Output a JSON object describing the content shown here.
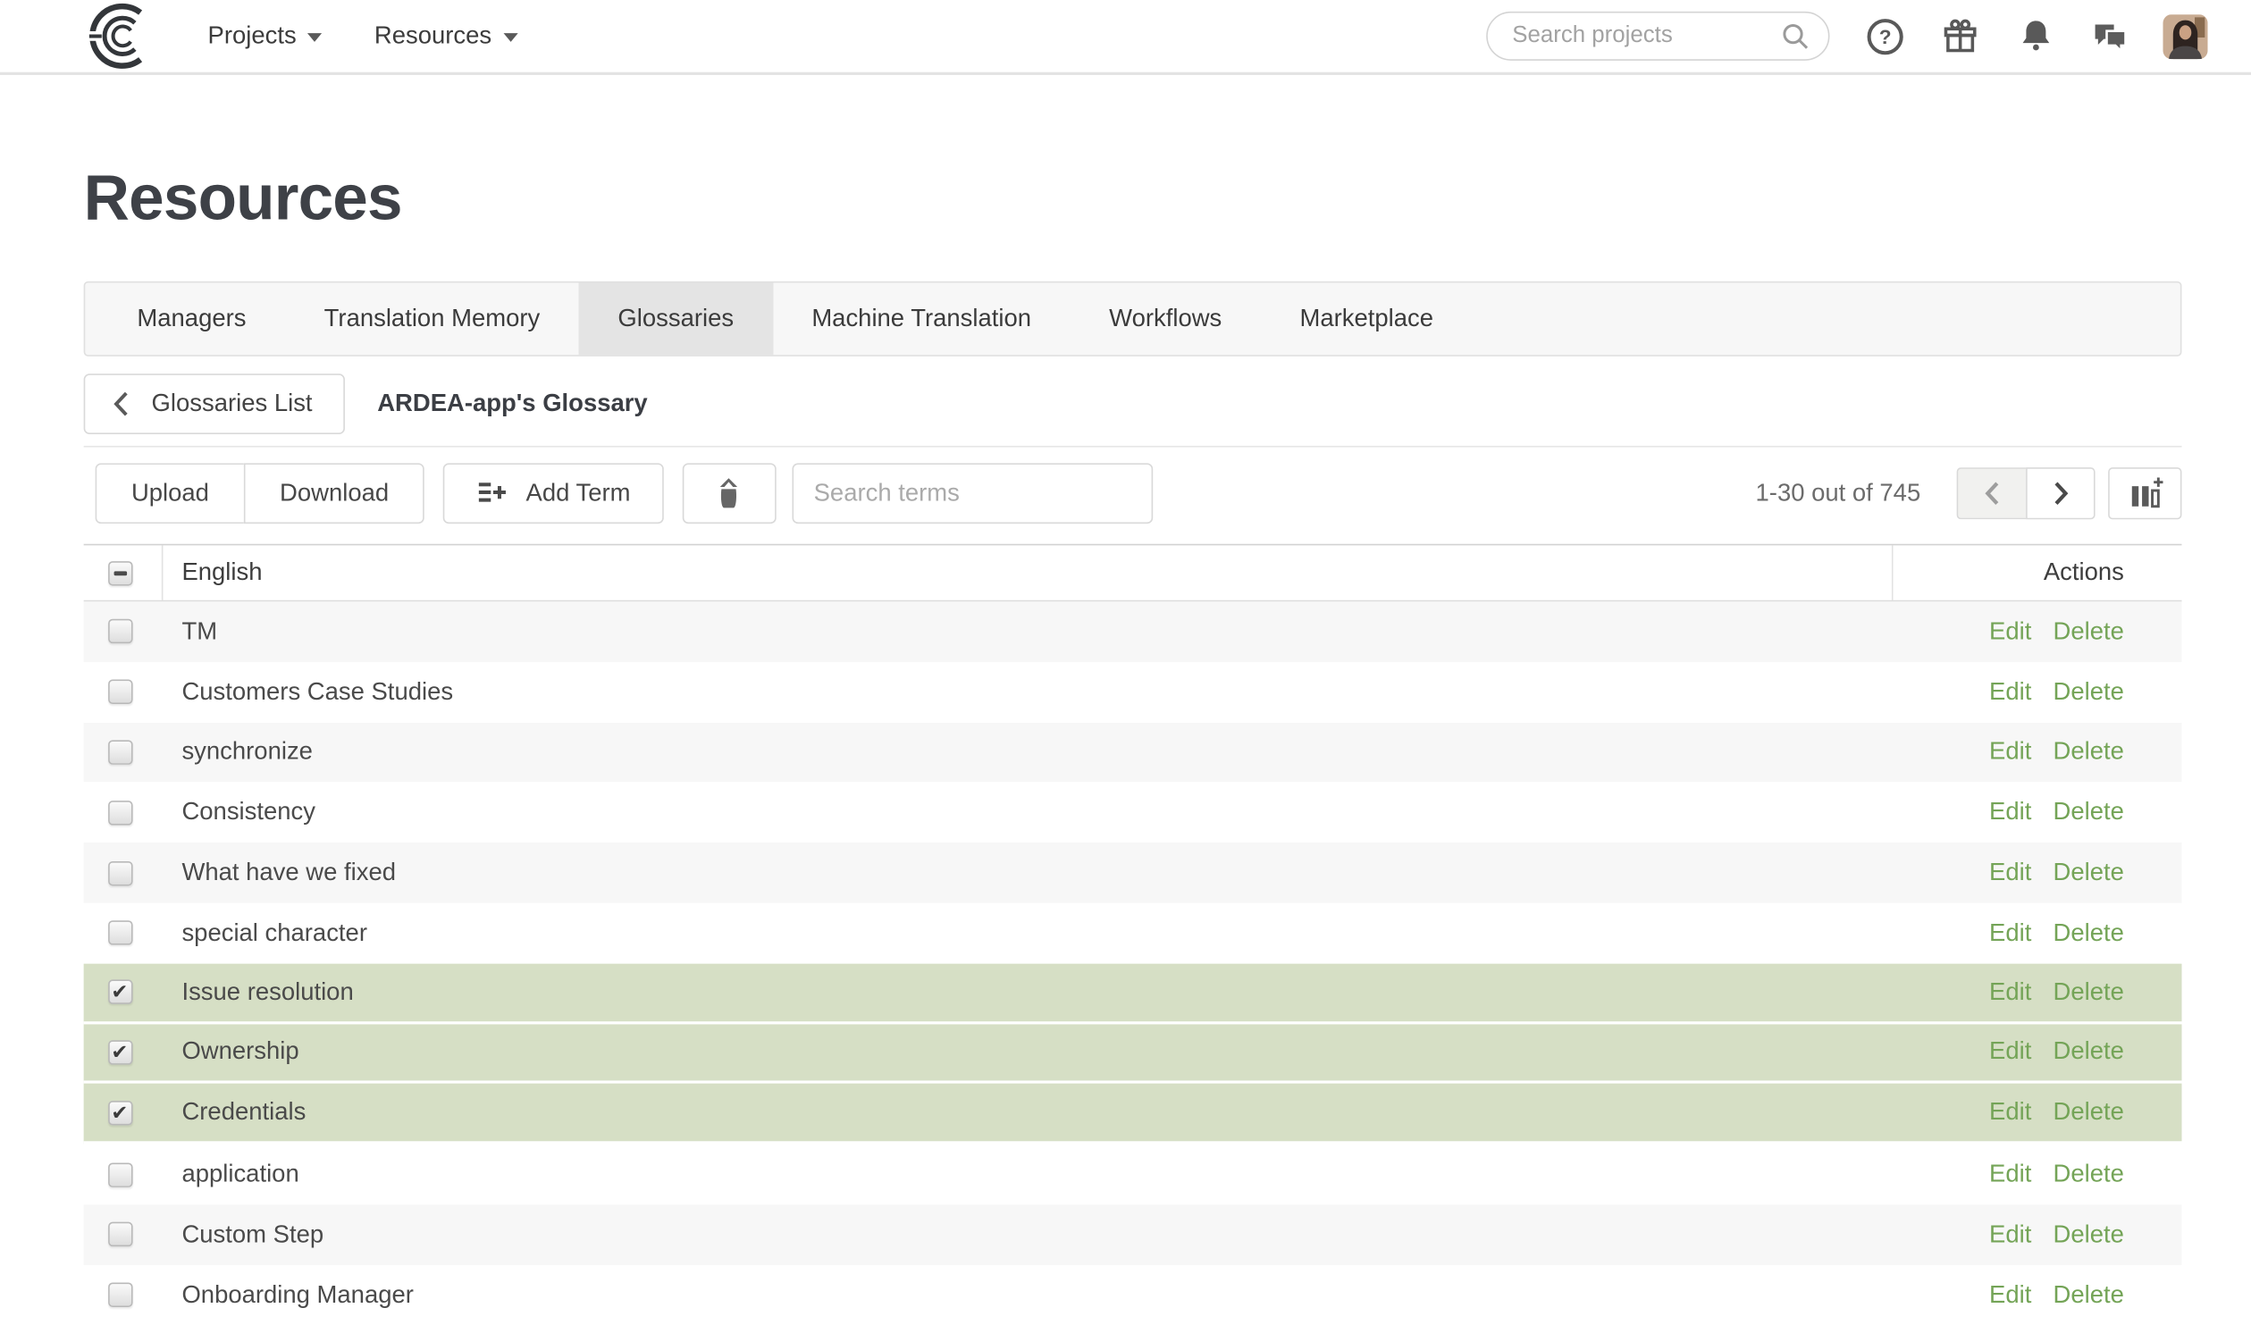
{
  "nav": {
    "menus": [
      {
        "label": "Projects"
      },
      {
        "label": "Resources"
      }
    ],
    "search_placeholder": "Search projects",
    "icons": [
      "help-icon",
      "gift-icon",
      "bell-icon",
      "chat-icon",
      "avatar"
    ]
  },
  "page": {
    "title": "Resources"
  },
  "tabs": [
    {
      "label": "Managers",
      "active": false
    },
    {
      "label": "Translation Memory",
      "active": false
    },
    {
      "label": "Glossaries",
      "active": true
    },
    {
      "label": "Machine Translation",
      "active": false
    },
    {
      "label": "Workflows",
      "active": false
    },
    {
      "label": "Marketplace",
      "active": false
    }
  ],
  "breadcrumb": {
    "back_label": "Glossaries List",
    "current": "ARDEA-app's Glossary"
  },
  "toolbar": {
    "upload_label": "Upload",
    "download_label": "Download",
    "add_term_label": "Add Term",
    "search_placeholder": "Search terms",
    "range_text": "1-30 out of 745"
  },
  "table": {
    "columns": {
      "term": "English",
      "actions": "Actions"
    },
    "edit_label": "Edit",
    "delete_label": "Delete",
    "header_checkbox_state": "indeterminate",
    "rows": [
      {
        "term": "TM",
        "checked": false,
        "zebra": true
      },
      {
        "term": "Customers Case Studies",
        "checked": false,
        "zebra": false
      },
      {
        "term": "synchronize",
        "checked": false,
        "zebra": true
      },
      {
        "term": "Consistency",
        "checked": false,
        "zebra": false
      },
      {
        "term": "What have we fixed",
        "checked": false,
        "zebra": true
      },
      {
        "term": "special character",
        "checked": false,
        "zebra": false
      },
      {
        "term": "Issue resolution",
        "checked": true,
        "zebra": true
      },
      {
        "term": "Ownership",
        "checked": true,
        "zebra": false
      },
      {
        "term": "Credentials",
        "checked": true,
        "zebra": true
      },
      {
        "term": "application",
        "checked": false,
        "zebra": false
      },
      {
        "term": "Custom Step",
        "checked": false,
        "zebra": true
      },
      {
        "term": "Onboarding Manager",
        "checked": false,
        "zebra": false
      }
    ]
  },
  "colors": {
    "selected_row_bg": "#d6dfc5",
    "link_green": "#74a457",
    "zebra_gray": "#f7f7f7",
    "active_tab_bg": "#e4e4e4"
  }
}
